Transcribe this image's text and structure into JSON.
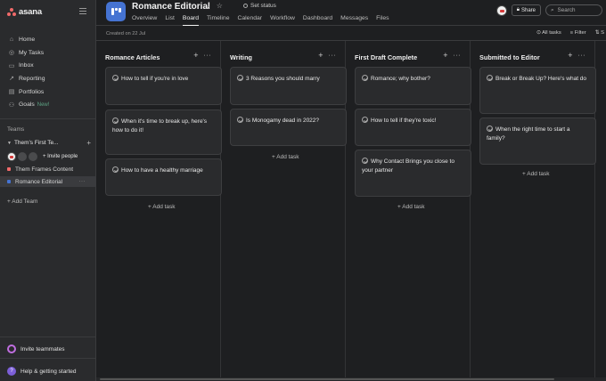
{
  "sidebar": {
    "logo": "asana",
    "nav": [
      {
        "label": "Home",
        "icon": "home-icon"
      },
      {
        "label": "My Tasks",
        "icon": "check-circle-icon"
      },
      {
        "label": "Inbox",
        "icon": "inbox-icon"
      },
      {
        "label": "Reporting",
        "icon": "chart-line-icon"
      },
      {
        "label": "Portfolios",
        "icon": "folder-icon"
      },
      {
        "label": "Goals",
        "icon": "person-icon",
        "badge": "New!"
      }
    ],
    "teams_heading": "Teams",
    "team_name": "Them's First Te...",
    "invite_people": "Invite people",
    "projects": [
      {
        "label": "Them Frames Content",
        "color": "#f06a6a"
      },
      {
        "label": "Romance Editorial",
        "color": "#4573d2",
        "more": "···"
      }
    ],
    "add_team": "Add Team",
    "invite_teammates": "Invite teammates",
    "help": "Help & getting started"
  },
  "header": {
    "project_title": "Romance Editorial",
    "set_status": "Set status",
    "tabs": [
      "Overview",
      "List",
      "Board",
      "Timeline",
      "Calendar",
      "Workflow",
      "Dashboard",
      "Messages",
      "Files"
    ],
    "active_tab": "Board",
    "share": "Share",
    "search_placeholder": "Search"
  },
  "subbar": {
    "created": "Created on 22 Jul",
    "all_tasks": "All tasks",
    "filter": "Filter",
    "sort": "S"
  },
  "board": {
    "add_task": "Add task",
    "columns": [
      {
        "title": "Romance Articles",
        "cards": [
          "How to tell if you're in love",
          "When it's time to break up, here's how to do it!",
          "How to have a healthy marriage"
        ]
      },
      {
        "title": "Writing",
        "cards": [
          "3 Reasons you should marry",
          "Is Monogamy dead in 2022?"
        ]
      },
      {
        "title": "First Draft Complete",
        "cards": [
          "Romance; why bother?",
          "How to tell if they're toxic!",
          "Why Contact Brings you close to your partner"
        ]
      },
      {
        "title": "Submitted to Editor",
        "cards": [
          "Break or Break Up? Here's what do",
          "When the right time to start a family?"
        ]
      }
    ]
  },
  "colors": {
    "background": "#1e1f21",
    "sidebar": "#2a2b2d",
    "project_icon": "#4573d2",
    "brand": "#f06a6a"
  }
}
